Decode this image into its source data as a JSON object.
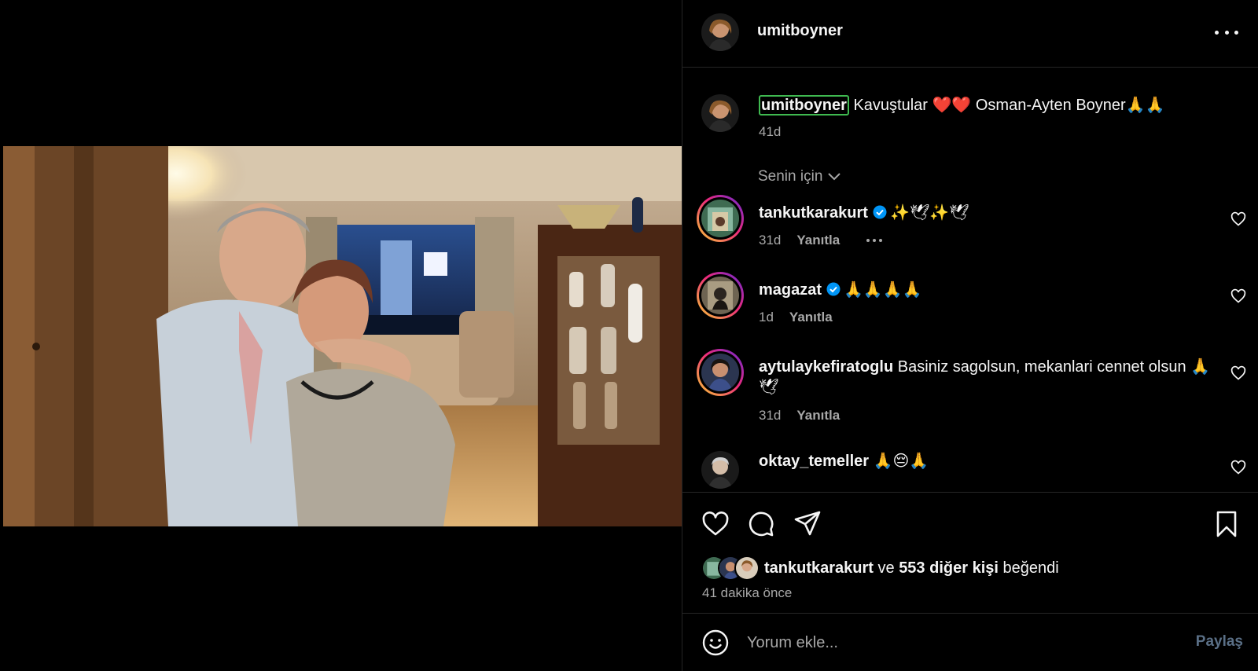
{
  "post": {
    "author": "umitboyner",
    "caption_text": "Kavuştular ❤️❤️ Osman-Ayten Boyner🙏🙏",
    "caption_time": "41d",
    "image_description_icon": "photo"
  },
  "filter": {
    "label": "Senin için",
    "icon": "chevron-down-icon"
  },
  "comments": [
    {
      "user": "tankutkarakurt",
      "verified": true,
      "text": "✨🕊✨🕊",
      "time": "31d",
      "reply": "Yanıtla",
      "has_more": true
    },
    {
      "user": "magazat",
      "verified": true,
      "text": "🙏🙏🙏🙏",
      "time": "1d",
      "reply": "Yanıtla",
      "has_more": false
    },
    {
      "user": "aytulaykefiratoglu",
      "verified": false,
      "text": "Basiniz sagolsun, mekanlari cennet olsun 🙏🕊",
      "time": "31d",
      "reply": "Yanıtla",
      "has_more": false
    },
    {
      "user": "oktay_temeller",
      "verified": false,
      "text": "🙏😔🙏",
      "time": "",
      "reply": "",
      "has_more": false
    }
  ],
  "likes": {
    "first_user": "tankutkarakurt",
    "connector": "ve",
    "others": "553 diğer kişi",
    "suffix": "beğendi"
  },
  "time_ago": "41 dakika önce",
  "compose": {
    "placeholder": "Yorum ekle...",
    "post_label": "Paylaş"
  },
  "colors": {
    "background": "#000000",
    "text": "#f5f5f5",
    "muted": "#a8a8a8",
    "verified": "#0095f6",
    "mention_outline": "#3fb950",
    "post_disabled": "#5a6f86"
  }
}
